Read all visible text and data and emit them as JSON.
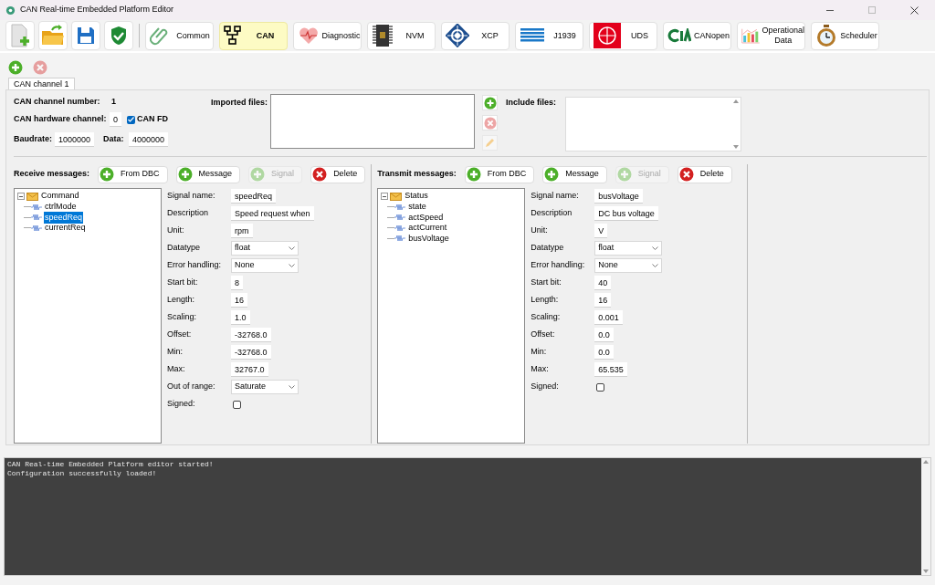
{
  "window": {
    "title": "CAN Real-time Embedded Platform Editor"
  },
  "modules": [
    {
      "label": "Common",
      "selected": false
    },
    {
      "label": "CAN",
      "selected": true
    },
    {
      "label": "Diagnostic",
      "selected": false
    },
    {
      "label": "NVM",
      "selected": false
    },
    {
      "label": "XCP",
      "selected": false
    },
    {
      "label": "J1939",
      "selected": false
    },
    {
      "label": "UDS",
      "selected": false
    },
    {
      "label": "CANopen",
      "selected": false
    },
    {
      "label": "Operational Data",
      "selected": false
    },
    {
      "label": "Scheduler",
      "selected": false
    }
  ],
  "tabs": [
    {
      "label": "CAN channel 1",
      "selected": true
    }
  ],
  "channel": {
    "number_label": "CAN channel number:",
    "number": "1",
    "hw_label": "CAN hardware channel:",
    "hw_value": "0",
    "can_fd": {
      "label": "CAN FD",
      "checked": true
    },
    "baudrate_label": "Baudrate:",
    "baudrate": "1000000",
    "data_label": "Data:",
    "data": "4000000",
    "imported_label": "Imported files:",
    "include_label": "Include files:"
  },
  "panels": [
    {
      "title": "Receive messages:",
      "buttons": [
        {
          "label": "From DBC",
          "kind": "add",
          "disabled": false
        },
        {
          "label": "Message",
          "kind": "add",
          "disabled": false
        },
        {
          "label": "Signal",
          "kind": "add",
          "disabled": true
        },
        {
          "label": "Delete",
          "kind": "delete",
          "disabled": false
        }
      ],
      "tree": {
        "label": "Command",
        "expanded": true,
        "children": [
          {
            "label": "ctrlMode",
            "selected": false
          },
          {
            "label": "speedReq",
            "selected": true
          },
          {
            "label": "currentReq",
            "selected": false
          }
        ]
      },
      "fields": [
        {
          "kind": "text",
          "label": "Signal name:",
          "value": "speedReq"
        },
        {
          "kind": "text",
          "label": "Description",
          "value": "Speed request when"
        },
        {
          "kind": "text",
          "label": "Unit:",
          "value": "rpm"
        },
        {
          "kind": "select",
          "label": "Datatype",
          "value": "float"
        },
        {
          "kind": "select",
          "label": "Error handling:",
          "value": "None"
        },
        {
          "kind": "text",
          "label": "Start bit:",
          "value": "8"
        },
        {
          "kind": "text",
          "label": "Length:",
          "value": "16"
        },
        {
          "kind": "text",
          "label": "Scaling:",
          "value": "1.0"
        },
        {
          "kind": "text",
          "label": "Offset:",
          "value": "-32768.0"
        },
        {
          "kind": "text",
          "label": "Min:",
          "value": "-32768.0"
        },
        {
          "kind": "text",
          "label": "Max:",
          "value": "32767.0"
        },
        {
          "kind": "select",
          "label": "Out of range:",
          "value": "Saturate"
        },
        {
          "kind": "checkbox",
          "label": "Signed:",
          "checked": false
        }
      ]
    },
    {
      "title": "Transmit messages:",
      "buttons": [
        {
          "label": "From DBC",
          "kind": "add",
          "disabled": false
        },
        {
          "label": "Message",
          "kind": "add",
          "disabled": false
        },
        {
          "label": "Signal",
          "kind": "add",
          "disabled": true
        },
        {
          "label": "Delete",
          "kind": "delete",
          "disabled": false
        }
      ],
      "tree": {
        "label": "Status",
        "expanded": true,
        "children": [
          {
            "label": "state",
            "selected": false
          },
          {
            "label": "actSpeed",
            "selected": false
          },
          {
            "label": "actCurrent",
            "selected": false
          },
          {
            "label": "busVoltage",
            "selected": false
          }
        ]
      },
      "fields": [
        {
          "kind": "text",
          "label": "Signal name:",
          "value": "busVoltage"
        },
        {
          "kind": "text",
          "label": "Description",
          "value": "DC bus voltage"
        },
        {
          "kind": "text",
          "label": "Unit:",
          "value": "V"
        },
        {
          "kind": "select",
          "label": "Datatype",
          "value": "float"
        },
        {
          "kind": "select",
          "label": "Error handling:",
          "value": "None"
        },
        {
          "kind": "text",
          "label": "Start bit:",
          "value": "40"
        },
        {
          "kind": "text",
          "label": "Length:",
          "value": "16"
        },
        {
          "kind": "text",
          "label": "Scaling:",
          "value": "0.001"
        },
        {
          "kind": "text",
          "label": "Offset:",
          "value": "0.0"
        },
        {
          "kind": "text",
          "label": "Min:",
          "value": "0.0"
        },
        {
          "kind": "text",
          "label": "Max:",
          "value": "65.535"
        },
        {
          "kind": "checkbox",
          "label": "Signed:",
          "checked": false
        }
      ]
    }
  ],
  "console": [
    "CAN Real-time Embedded Platform editor started!",
    "Configuration successfully loaded!"
  ]
}
